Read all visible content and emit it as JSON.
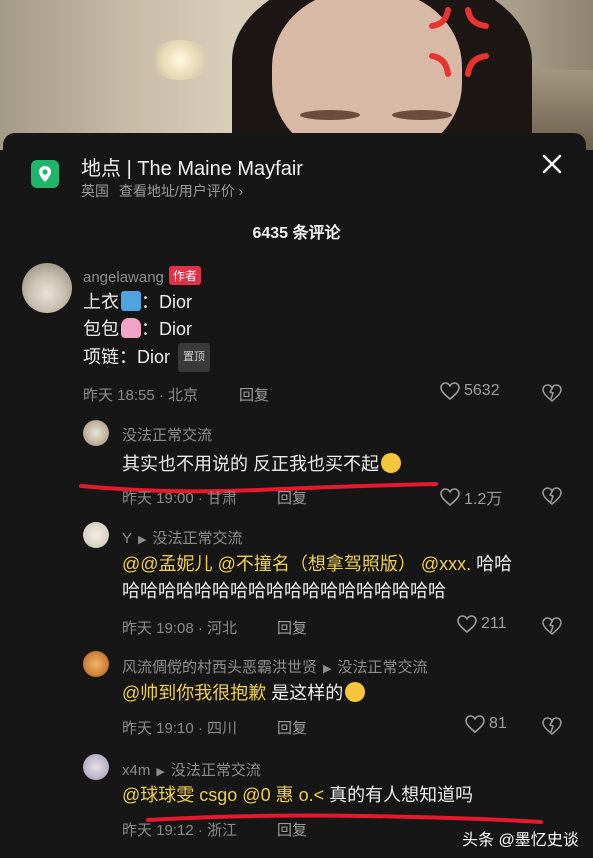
{
  "location": {
    "label": "地点",
    "name": "The Maine Mayfair",
    "country": "英国",
    "link_text": "查看地址/用户评价 ›"
  },
  "comment_count": "6435 条评论",
  "comments": [
    {
      "user": "angelawang",
      "badge": "作者",
      "lines": [
        "上衣",
        "：Dior",
        "包包",
        "：Dior",
        "项链：Dior"
      ],
      "pinned": "置顶",
      "meta": "昨天 18:55 · 北京",
      "reply": "回复",
      "likes": "5632"
    },
    {
      "user": "没法正常交流",
      "text": "其实也不用说的 反正我也买不起",
      "meta": "昨天 19:00 · 甘肃",
      "reply": "回复",
      "likes": "1.2万"
    },
    {
      "user": "Y",
      "reply_to": "没法正常交流",
      "mention1": "@@孟妮儿",
      "mention2": "@不撞名（想拿驾照版）",
      "mention3": "@xxx.",
      "text_tail": "哈哈",
      "text_line2": "哈哈哈哈哈哈哈哈哈哈哈哈哈哈哈哈哈哈",
      "meta": "昨天 19:08 · 河北",
      "reply": "回复",
      "likes": "211"
    },
    {
      "user": "风流倜傥的村西头恶霸洪世贤",
      "reply_to": "没法正常交流",
      "mention": "@帅到你我很抱歉",
      "text": " 是这样的",
      "meta": "昨天 19:10 · 四川",
      "reply": "回复",
      "likes": "81"
    },
    {
      "user": "x4m",
      "reply_to": "没法正常交流",
      "mention": "@球球雯 csgo @0 惠 o.<",
      "text": " 真的有人想知道吗",
      "meta": "昨天 19:12 · 浙江",
      "reply": "回复"
    }
  ],
  "watermark": "头条 @墨忆史谈",
  "colors": {
    "accent_red": "#e03148",
    "mention": "#f0d04f",
    "location_green": "#1fb66b",
    "underline": "#e8192c"
  }
}
